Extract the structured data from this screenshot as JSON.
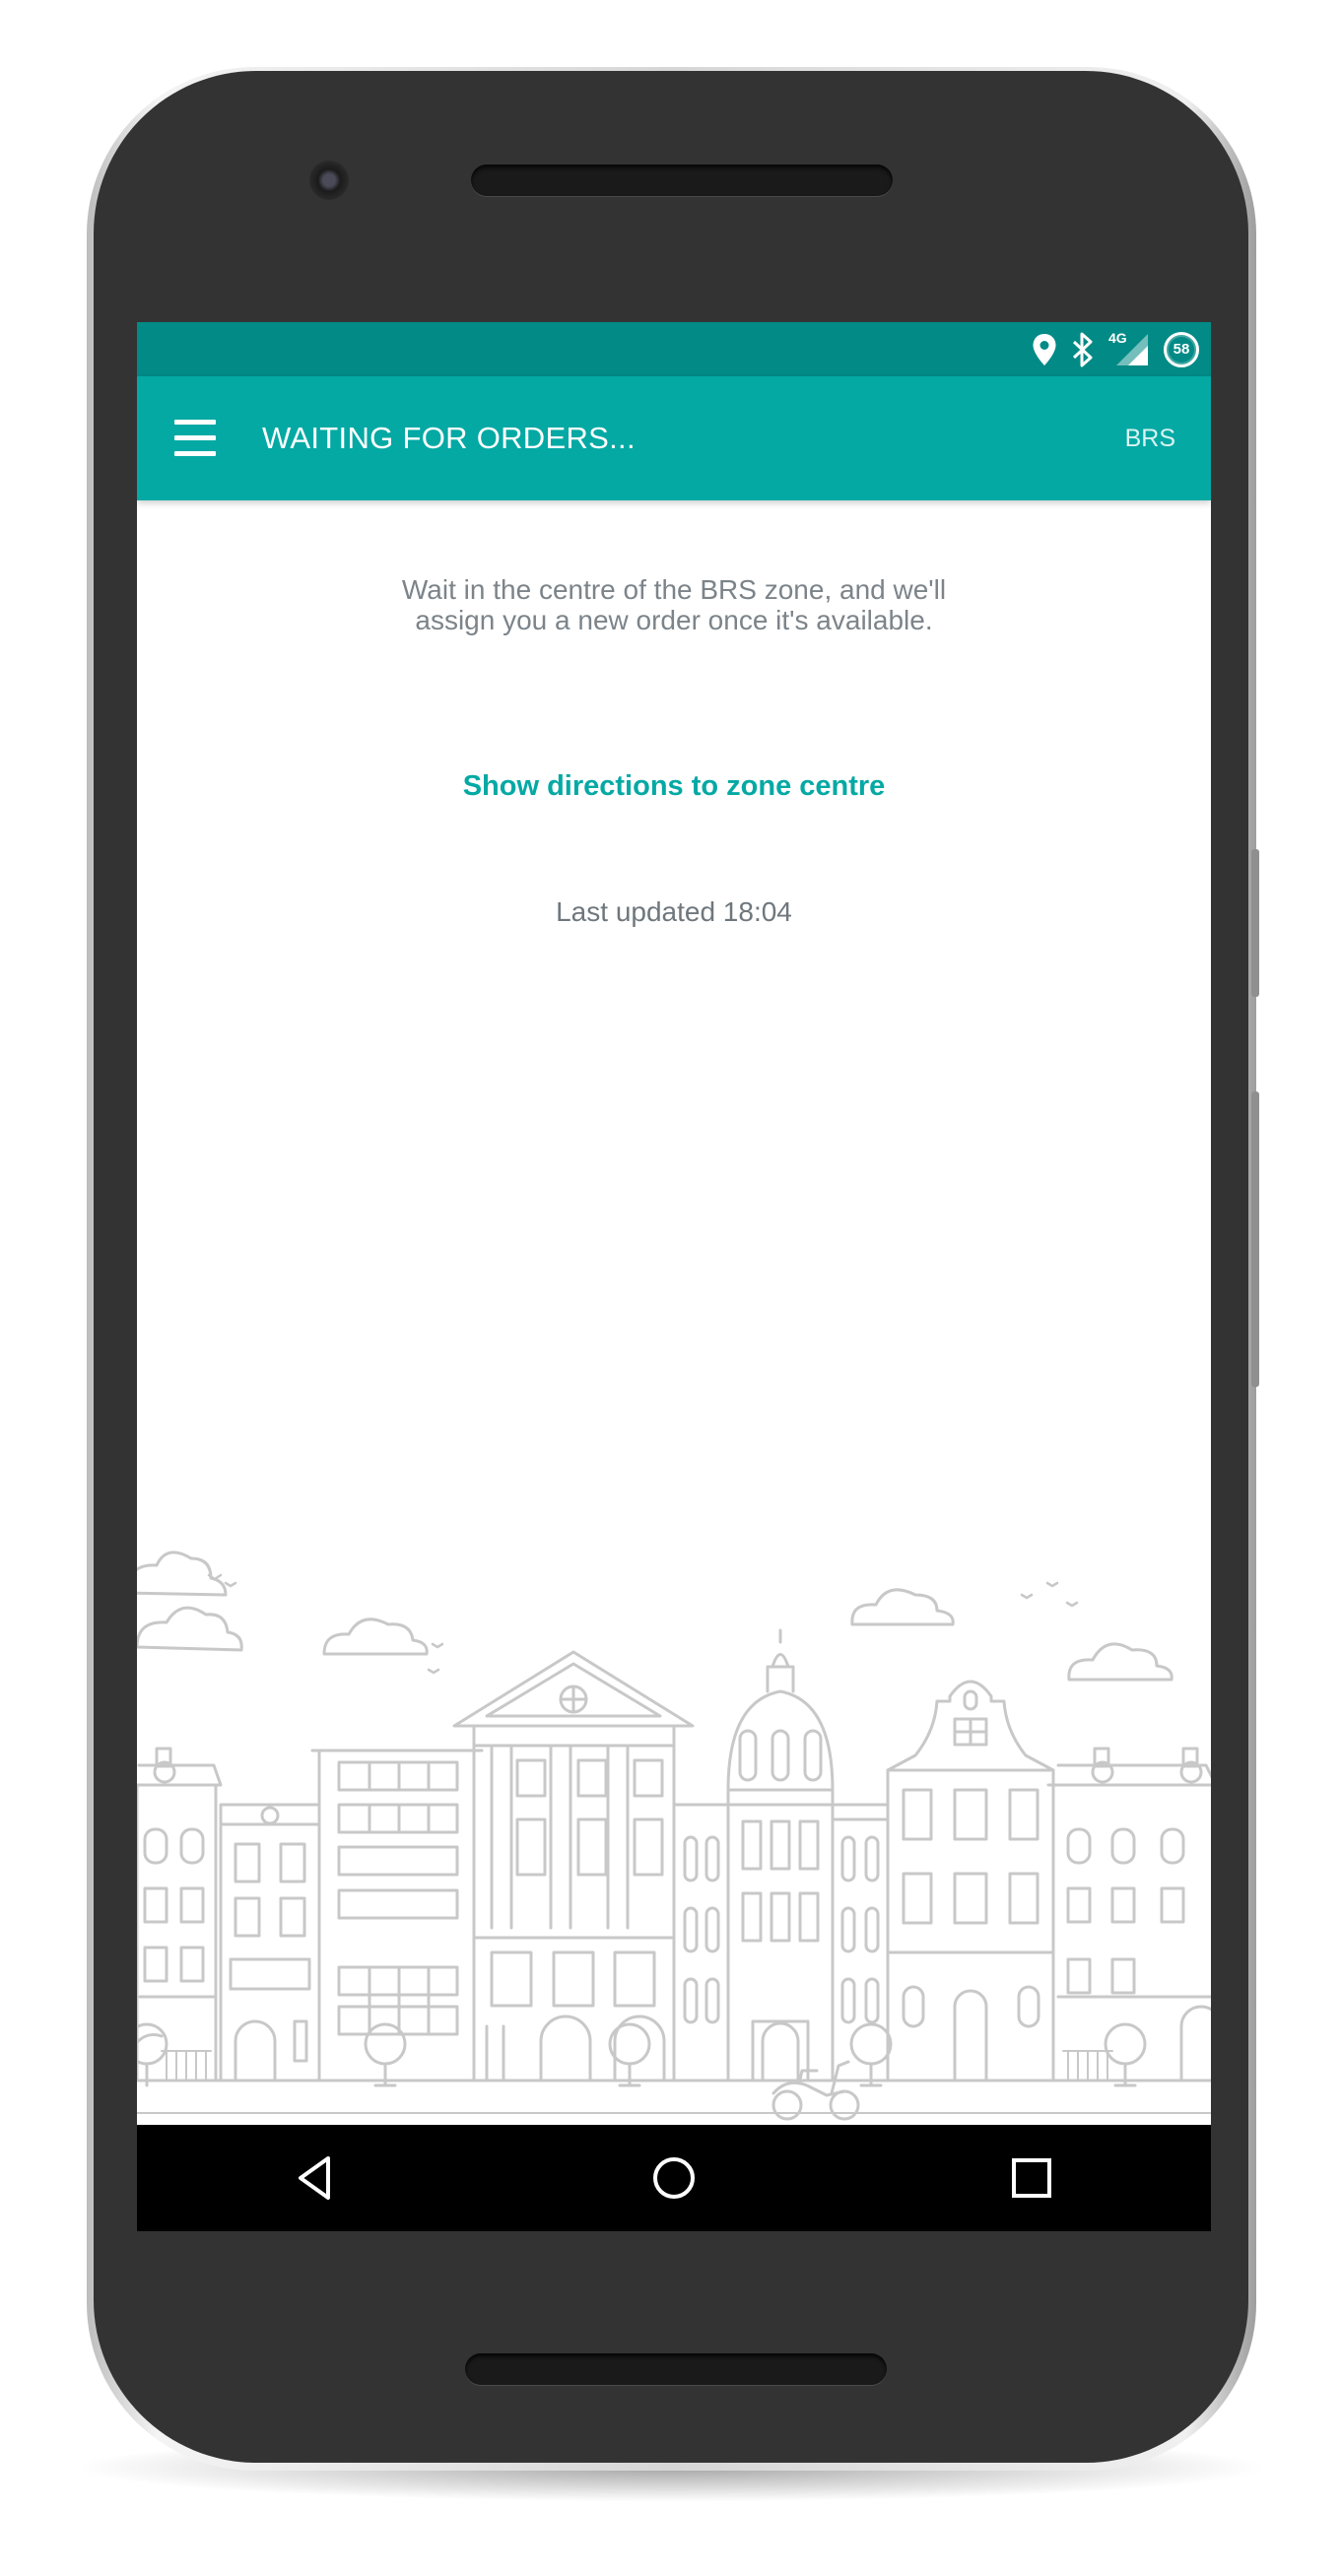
{
  "status_bar": {
    "icons": [
      "location-pin-icon",
      "bluetooth-icon",
      "signal-4g-icon",
      "battery-icon"
    ],
    "network_label": "4G",
    "battery_level": "58"
  },
  "app_bar": {
    "menu_icon": "hamburger-menu-icon",
    "title": "WAITING FOR ORDERS...",
    "zone_code": "BRS"
  },
  "main": {
    "wait_message": "Wait in the centre of the BRS zone, and we'll assign you a new order once it's available.",
    "directions_link": "Show directions to zone centre",
    "last_updated": "Last updated 18:04"
  },
  "illustration": {
    "name": "city-street-illustration"
  },
  "nav_bar": {
    "buttons": [
      "back-icon",
      "home-icon",
      "recents-icon"
    ]
  },
  "colors": {
    "status_bar": "#028a86",
    "app_bar": "#04a9a4",
    "accent": "#04a9a4",
    "body_text": "#7c848a",
    "phone_body": "#333333",
    "illustration_stroke": "#c8c8c8"
  }
}
